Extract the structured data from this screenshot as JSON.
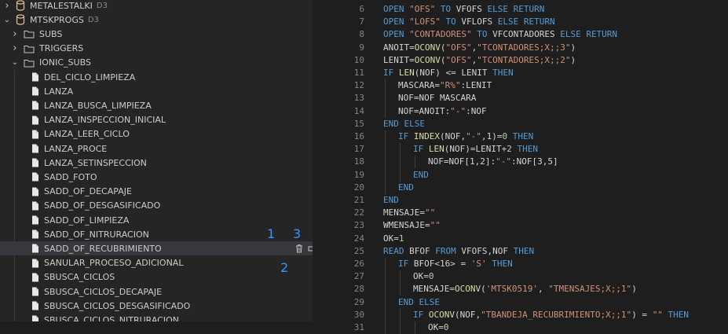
{
  "sidebar": {
    "items": [
      {
        "label": "METALESTALKI",
        "hint": "D3",
        "type": "db",
        "depth": 0,
        "chevron": "right"
      },
      {
        "label": "MTSKPROGS",
        "hint": "D3",
        "type": "db",
        "depth": 0,
        "chevron": "down"
      },
      {
        "label": "SUBS",
        "type": "folder",
        "depth": 1,
        "chevron": "right"
      },
      {
        "label": "TRIGGERS",
        "type": "folder",
        "depth": 1,
        "chevron": "right"
      },
      {
        "label": "IONIC_SUBS",
        "type": "folder",
        "depth": 1,
        "chevron": "down"
      },
      {
        "label": "DEL_CICLO_LIMPIEZA",
        "type": "file",
        "depth": 2
      },
      {
        "label": "LANZA",
        "type": "file",
        "depth": 2
      },
      {
        "label": "LANZA_BUSCA_LIMPIEZA",
        "type": "file",
        "depth": 2
      },
      {
        "label": "LANZA_INSPECCION_INICIAL",
        "type": "file",
        "depth": 2
      },
      {
        "label": "LANZA_LEER_CICLO",
        "type": "file",
        "depth": 2
      },
      {
        "label": "LANZA_PROCE",
        "type": "file",
        "depth": 2
      },
      {
        "label": "LANZA_SETINSPECCION",
        "type": "file",
        "depth": 2
      },
      {
        "label": "SADD_FOTO",
        "type": "file",
        "depth": 2
      },
      {
        "label": "SADD_OF_DECAPAJE",
        "type": "file",
        "depth": 2
      },
      {
        "label": "SADD_OF_DESGASIFICADO",
        "type": "file",
        "depth": 2
      },
      {
        "label": "SADD_OF_LIMPIEZA",
        "type": "file",
        "depth": 2
      },
      {
        "label": "SADD_OF_NITRURACION",
        "type": "file",
        "depth": 2
      },
      {
        "label": "SADD_OF_RECUBRIMIENTO",
        "type": "file",
        "depth": 2,
        "selected": true
      },
      {
        "label": "SANULAR_PROCESO_ADICIONAL",
        "type": "file",
        "depth": 2
      },
      {
        "label": "SBUSCA_CICLOS",
        "type": "file",
        "depth": 2
      },
      {
        "label": "SBUSCA_CICLOS_DECAPAJE",
        "type": "file",
        "depth": 2
      },
      {
        "label": "SBUSCA_CICLOS_DESGASIFICADO",
        "type": "file",
        "depth": 2
      },
      {
        "label": "SBUSCA_CICLOS_NITRURACION",
        "type": "file",
        "depth": 2
      }
    ],
    "row_actions": [
      "trash-icon",
      "compile-icon",
      "edit-catalog-icon"
    ],
    "annotations": {
      "one": "1",
      "two": "2",
      "three": "3"
    }
  },
  "editor": {
    "lines": [
      {
        "n": "6",
        "indent": 1,
        "tokens": [
          [
            "k",
            "OPEN "
          ],
          [
            "s",
            "\"OFS\""
          ],
          [
            "k",
            " TO "
          ],
          [
            "p",
            "VFOFS "
          ],
          [
            "k",
            "ELSE RETURN"
          ]
        ]
      },
      {
        "n": "7",
        "indent": 1,
        "tokens": [
          [
            "k",
            "OPEN "
          ],
          [
            "s",
            "\"LOFS\""
          ],
          [
            "k",
            " TO "
          ],
          [
            "p",
            "VFLOFS "
          ],
          [
            "k",
            "ELSE RETURN"
          ]
        ]
      },
      {
        "n": "8",
        "indent": 1,
        "tokens": [
          [
            "k",
            "OPEN "
          ],
          [
            "s",
            "\"CONTADORES\""
          ],
          [
            "k",
            " TO "
          ],
          [
            "p",
            "VFCONTADORES "
          ],
          [
            "k",
            "ELSE RETURN"
          ]
        ]
      },
      {
        "n": "9",
        "indent": 1,
        "tokens": [
          [
            "p",
            "ANOIT="
          ],
          [
            "f",
            "OCONV"
          ],
          [
            "p",
            "("
          ],
          [
            "s",
            "\"OFS\""
          ],
          [
            "p",
            ","
          ],
          [
            "s",
            "\"TCONTADORES;X;;3\""
          ],
          [
            "p",
            ")"
          ]
        ]
      },
      {
        "n": "10",
        "indent": 1,
        "tokens": [
          [
            "p",
            "LENIT="
          ],
          [
            "f",
            "OCONV"
          ],
          [
            "p",
            "("
          ],
          [
            "s",
            "\"OFS\""
          ],
          [
            "p",
            ","
          ],
          [
            "s",
            "\"TCONTADORES;X;;2\""
          ],
          [
            "p",
            ")"
          ]
        ]
      },
      {
        "n": "11",
        "indent": 1,
        "tokens": [
          [
            "k",
            "IF "
          ],
          [
            "f",
            "LEN"
          ],
          [
            "p",
            "(NOF) <= LENIT "
          ],
          [
            "k",
            "THEN"
          ]
        ]
      },
      {
        "n": "12",
        "indent": 2,
        "tokens": [
          [
            "p",
            "MASCARA="
          ],
          [
            "s",
            "\"R%\""
          ],
          [
            "p",
            ":LENIT"
          ]
        ]
      },
      {
        "n": "13",
        "indent": 2,
        "tokens": [
          [
            "p",
            "NOF=NOF MASCARA"
          ]
        ]
      },
      {
        "n": "14",
        "indent": 2,
        "tokens": [
          [
            "p",
            "NOF=ANOIT:"
          ],
          [
            "s",
            "\"-\""
          ],
          [
            "p",
            ":NOF"
          ]
        ]
      },
      {
        "n": "15",
        "indent": 1,
        "tokens": [
          [
            "k",
            "END ELSE"
          ]
        ]
      },
      {
        "n": "16",
        "indent": 2,
        "tokens": [
          [
            "k",
            "IF "
          ],
          [
            "f",
            "INDEX"
          ],
          [
            "p",
            "(NOF,"
          ],
          [
            "s",
            "\"-\""
          ],
          [
            "p",
            ",1)="
          ],
          [
            "n",
            "0"
          ],
          [
            "k",
            " THEN"
          ]
        ]
      },
      {
        "n": "17",
        "indent": 3,
        "tokens": [
          [
            "k",
            "IF "
          ],
          [
            "f",
            "LEN"
          ],
          [
            "p",
            "(NOF)=LENIT+"
          ],
          [
            "n",
            "2"
          ],
          [
            "k",
            " THEN"
          ]
        ]
      },
      {
        "n": "18",
        "indent": 4,
        "tokens": [
          [
            "p",
            "NOF=NOF[1,2]:"
          ],
          [
            "s",
            "\"-\""
          ],
          [
            "p",
            ":NOF[3,5]"
          ]
        ]
      },
      {
        "n": "19",
        "indent": 3,
        "tokens": [
          [
            "k",
            "END"
          ]
        ]
      },
      {
        "n": "20",
        "indent": 2,
        "tokens": [
          [
            "k",
            "END"
          ]
        ]
      },
      {
        "n": "21",
        "indent": 1,
        "tokens": [
          [
            "k",
            "END"
          ]
        ]
      },
      {
        "n": "22",
        "indent": 1,
        "tokens": [
          [
            "p",
            "MENSAJE="
          ],
          [
            "s",
            "\"\""
          ]
        ]
      },
      {
        "n": "23",
        "indent": 1,
        "tokens": [
          [
            "p",
            "WMENSAJE="
          ],
          [
            "s",
            "\"\""
          ]
        ]
      },
      {
        "n": "24",
        "indent": 1,
        "tokens": [
          [
            "p",
            "OK="
          ],
          [
            "n",
            "1"
          ]
        ]
      },
      {
        "n": "25",
        "indent": 1,
        "tokens": [
          [
            "k",
            "READ "
          ],
          [
            "p",
            "BFOF "
          ],
          [
            "k",
            "FROM "
          ],
          [
            "p",
            "VFOFS,NOF "
          ],
          [
            "k",
            "THEN"
          ]
        ]
      },
      {
        "n": "26",
        "indent": 2,
        "tokens": [
          [
            "k",
            "IF "
          ],
          [
            "p",
            "BFOF<16> = "
          ],
          [
            "s",
            "'S'"
          ],
          [
            "k",
            " THEN"
          ]
        ]
      },
      {
        "n": "27",
        "indent": 3,
        "tokens": [
          [
            "p",
            "OK="
          ],
          [
            "n",
            "0"
          ]
        ]
      },
      {
        "n": "28",
        "indent": 3,
        "tokens": [
          [
            "p",
            "MENSAJE="
          ],
          [
            "f",
            "OCONV"
          ],
          [
            "p",
            "("
          ],
          [
            "s",
            "'MTSK0519'"
          ],
          [
            "p",
            ", "
          ],
          [
            "s",
            "\"TMENSAJES;X;;1\""
          ],
          [
            "p",
            ")"
          ]
        ]
      },
      {
        "n": "29",
        "indent": 2,
        "tokens": [
          [
            "k",
            "END ELSE"
          ]
        ]
      },
      {
        "n": "30",
        "indent": 3,
        "tokens": [
          [
            "k",
            "IF "
          ],
          [
            "f",
            "OCONV"
          ],
          [
            "p",
            "(NOF,"
          ],
          [
            "s",
            "\"TBANDEJA_RECUBRIMIENTO;X;;1\""
          ],
          [
            "p",
            ") = "
          ],
          [
            "s",
            "\"\""
          ],
          [
            "k",
            " THEN"
          ]
        ]
      },
      {
        "n": "31",
        "indent": 4,
        "tokens": [
          [
            "p",
            "OK="
          ],
          [
            "n",
            "0"
          ]
        ]
      }
    ]
  },
  "colors": {
    "keyword": "#569cd6",
    "string": "#ce9178",
    "function": "#dcdcaa",
    "number": "#b5cea8",
    "text": "#d4d4d4",
    "line_number": "#858585",
    "sidebar_bg": "#252526",
    "editor_bg": "#1e1e1e",
    "selected_row": "#37373d",
    "annotation": "#3794ff"
  }
}
